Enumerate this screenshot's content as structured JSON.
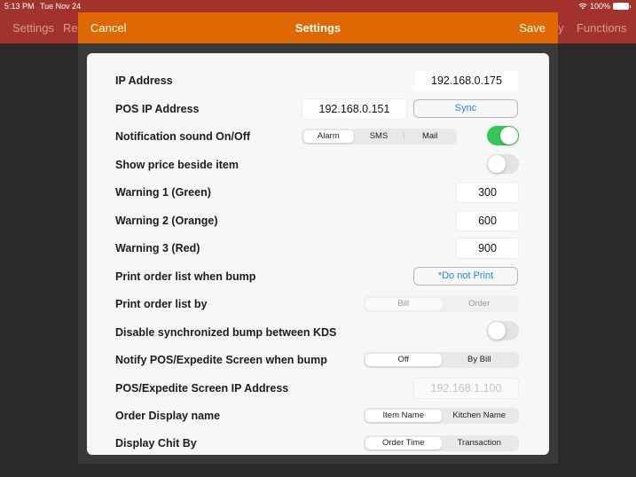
{
  "status_bar": {
    "time": "5:13 PM",
    "date": "Tue Nov 24",
    "battery": "100%"
  },
  "app_bar": {
    "tabs": [
      "Settings",
      "Rep",
      "y",
      "Functions"
    ]
  },
  "modal": {
    "title": "Settings",
    "cancel_label": "Cancel",
    "save_label": "Save"
  },
  "settings": {
    "ip_address": {
      "label": "IP Address",
      "value": "192.168.0.175"
    },
    "pos_ip_address": {
      "label": "POS IP Address",
      "value": "192.168.0.151",
      "sync_label": "Sync"
    },
    "notification_sound": {
      "label": "Notification sound On/Off",
      "options": [
        "Alarm",
        "SMS",
        "Mail"
      ],
      "selected": "Alarm",
      "enabled": true
    },
    "show_price": {
      "label": "Show price beside item",
      "enabled": false
    },
    "warning1": {
      "label": "Warning 1 (Green)",
      "value": "300"
    },
    "warning2": {
      "label": "Warning 2 (Orange)",
      "value": "600"
    },
    "warning3": {
      "label": "Warning 3 (Red)",
      "value": "900"
    },
    "print_when_bump": {
      "label": "Print order list when bump",
      "value": "*Do not Print"
    },
    "print_by": {
      "label": "Print order list by",
      "options": [
        "Bill",
        "Order"
      ],
      "selected": "Bill",
      "disabled": true
    },
    "disable_sync_bump": {
      "label": "Disable synchronized bump between KDS",
      "enabled": false
    },
    "notify_pos": {
      "label": "Notify POS/Expedite Screen when bump",
      "options": [
        "Off",
        "By Bill"
      ],
      "selected": "Off"
    },
    "pos_expedite_ip": {
      "label": "POS/Expedite Screen IP Address",
      "placeholder": "192.168.1.100"
    },
    "order_display_name": {
      "label": "Order Display name",
      "options": [
        "Item Name",
        "Kitchen Name"
      ],
      "selected": "Item Name"
    },
    "display_chit_by": {
      "label": "Display Chit By",
      "options": [
        "Order Time",
        "Transaction"
      ],
      "selected": "Order Time"
    }
  },
  "colors": {
    "status_bar": "#a1332c",
    "modal_header": "#e06800",
    "toggle_on": "#34c759",
    "link_blue": "#1a86f0"
  }
}
